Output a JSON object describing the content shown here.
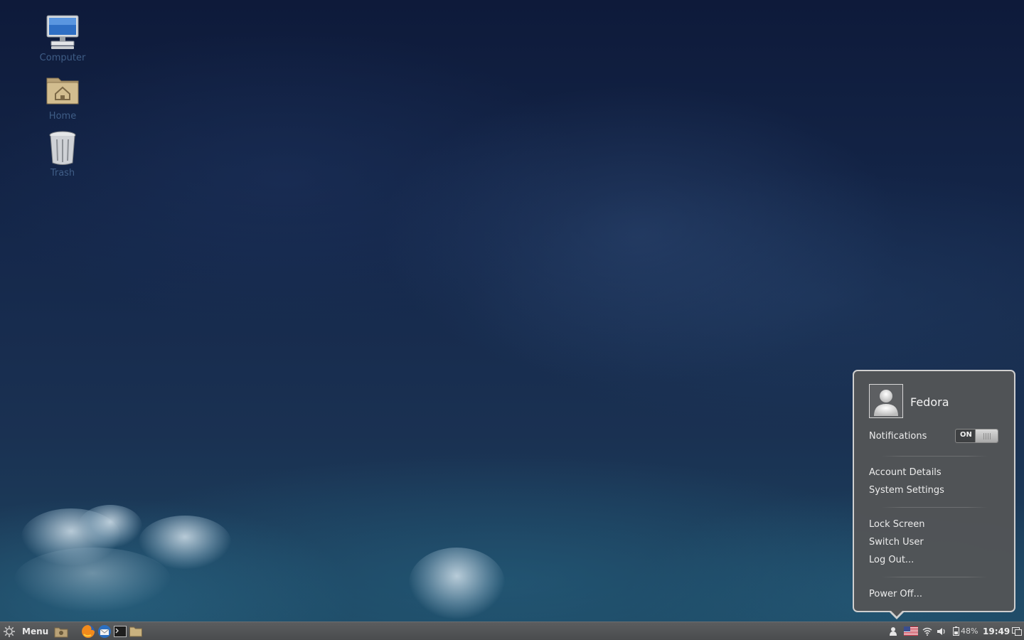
{
  "desktop": {
    "icons": [
      {
        "label": "Computer",
        "icon": "computer-icon"
      },
      {
        "label": "Home",
        "icon": "home-folder-icon"
      },
      {
        "label": "Trash",
        "icon": "trash-icon"
      }
    ]
  },
  "user_menu": {
    "user_name": "Fedora",
    "notifications_label": "Notifications",
    "notifications_toggle": "ON",
    "items_group1": [
      "Account Details",
      "System Settings"
    ],
    "items_group2": [
      "Lock Screen",
      "Switch User",
      "Log Out..."
    ],
    "items_group3": [
      "Power Off..."
    ]
  },
  "panel": {
    "menu_label": "Menu",
    "launchers": [
      "show-desktop-icon",
      "firefox-icon",
      "thunderbird-icon",
      "terminal-icon",
      "files-icon"
    ],
    "tray": {
      "user_icon": "user-icon",
      "keyboard_layout_icon": "us-flag-icon",
      "network_icon": "wifi-icon",
      "volume_icon": "volume-icon",
      "battery_percent": "48%",
      "clock": "19:49",
      "workspace_icon": "window-list-icon"
    }
  },
  "colors": {
    "panel_bg": "#4e5052",
    "menu_bg": "#525456",
    "menu_border": "#cfcfcf",
    "desktop_top": "#0e1a3a",
    "desktop_bottom": "#1d4560"
  }
}
